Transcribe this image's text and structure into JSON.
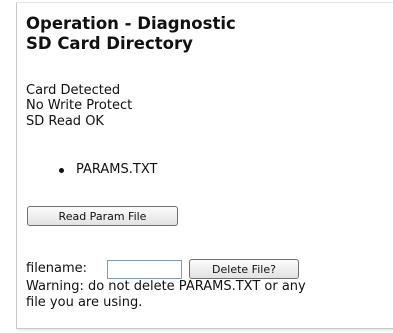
{
  "header": {
    "title_line1": "Operation - Diagnostic",
    "title_line2": "SD Card Directory"
  },
  "status": {
    "card": "Card Detected",
    "write_protect": "No Write Protect",
    "read": "SD Read OK"
  },
  "files": [
    "PARAMS.TXT"
  ],
  "buttons": {
    "read_param": "Read Param File",
    "delete_file": "Delete File?"
  },
  "delete_form": {
    "label": "filename:",
    "value": "",
    "placeholder": ""
  },
  "warning": {
    "line1": "Warning: do not delete PARAMS.TXT or any",
    "line2": "file you are using."
  }
}
